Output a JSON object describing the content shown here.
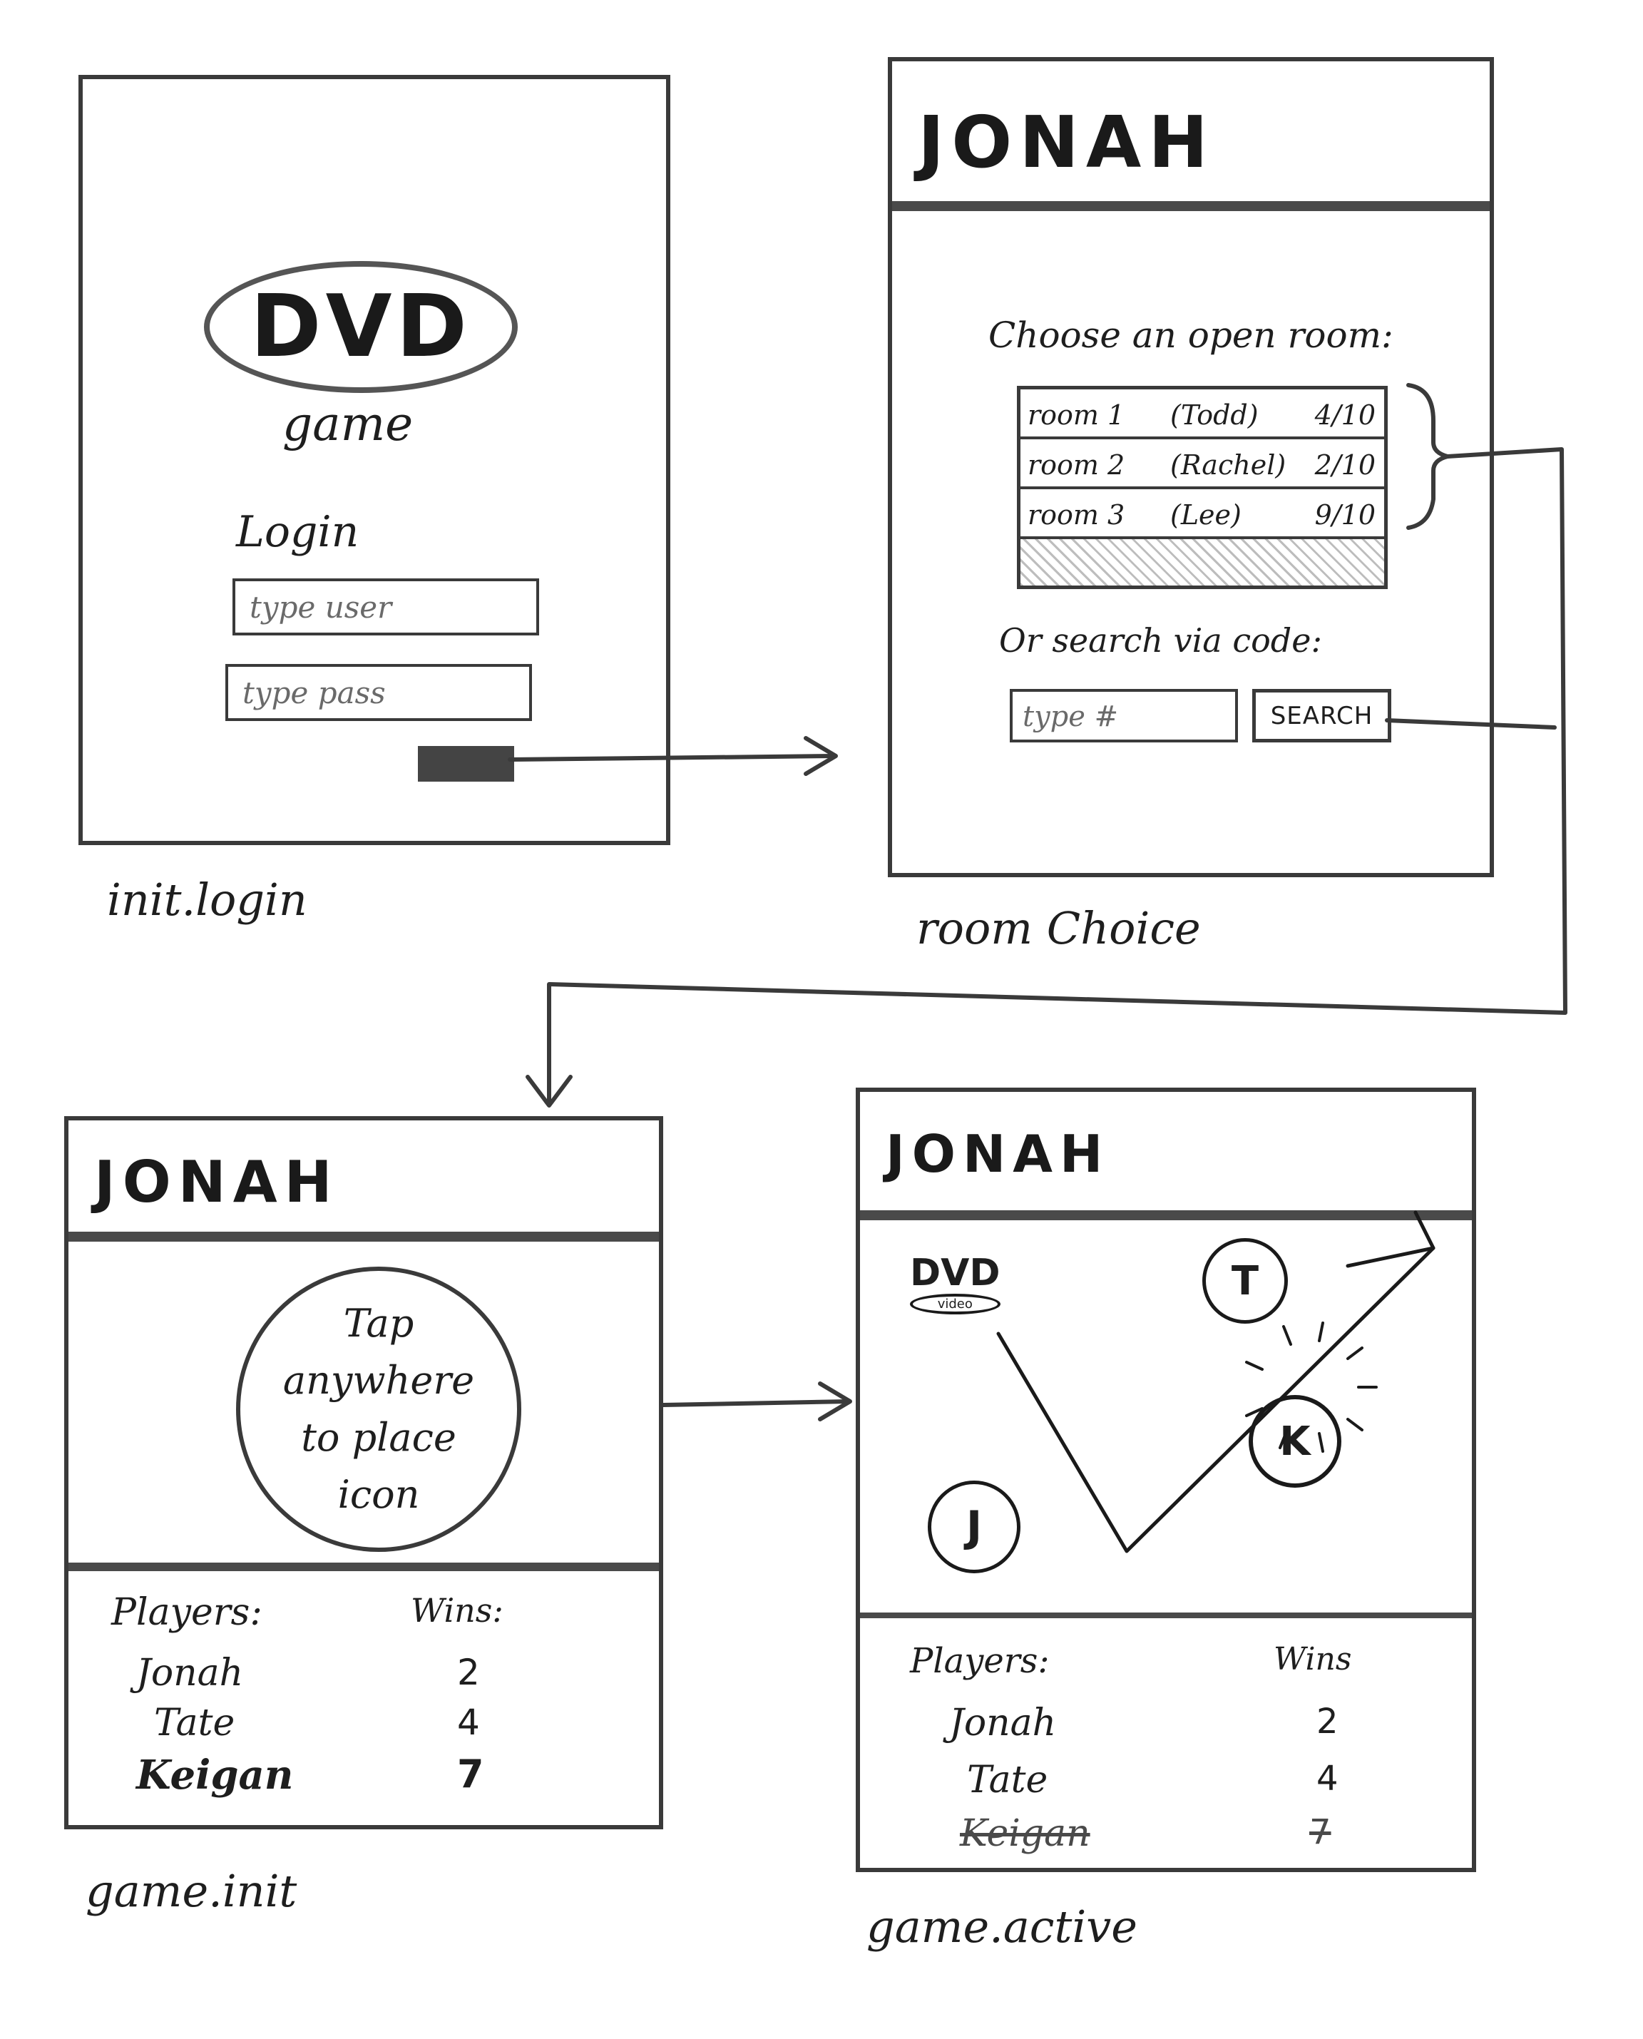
{
  "screens": {
    "login": {
      "logo": "DVD",
      "logo_sub": "game",
      "login_label": "Login",
      "user_placeholder": "type user",
      "pass_placeholder": "type pass",
      "caption": "init.login"
    },
    "room_choice": {
      "header": "JONAH",
      "prompt": "Choose an open room:",
      "rooms": [
        {
          "name": "room 1",
          "host": "(Todd)",
          "count": "4/10"
        },
        {
          "name": "room 2",
          "host": "(Rachel)",
          "count": "2/10"
        },
        {
          "name": "room 3",
          "host": "(Lee)",
          "count": "9/10"
        }
      ],
      "search_prompt": "Or search via code:",
      "code_placeholder": "type #",
      "search_label": "SEARCH",
      "caption": "room Choice"
    },
    "game_init": {
      "header": "JONAH",
      "tap_hint": "Tap anywhere to place icon",
      "players_label": "Players:",
      "wins_label": "Wins:",
      "players": [
        {
          "name": "Jonah",
          "wins": "2"
        },
        {
          "name": "Tate",
          "wins": "4"
        },
        {
          "name": "Keigan",
          "wins": "7"
        }
      ],
      "caption": "game.init"
    },
    "game_active": {
      "header": "JONAH",
      "dvd_logo": "DVD",
      "dvd_sub": "video",
      "token_t": "T",
      "token_k": "K",
      "token_j": "J",
      "players_label": "Players:",
      "wins_label": "Wins",
      "players": [
        {
          "name": "Jonah",
          "wins": "2",
          "eliminated": false
        },
        {
          "name": "Tate",
          "wins": "4",
          "eliminated": false
        },
        {
          "name": "Keigan",
          "wins": "7",
          "eliminated": true
        }
      ],
      "caption": "game.active"
    }
  },
  "colors": {
    "ink": "#1e1e1e",
    "frame": "#3a3a3a",
    "shade": "#9a9a9a"
  }
}
